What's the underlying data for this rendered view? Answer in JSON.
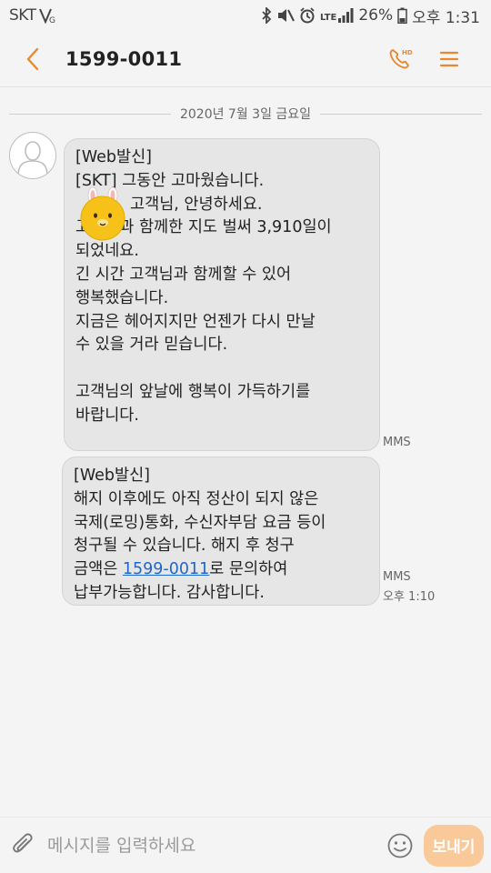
{
  "status_bar": {
    "carrier": "SKT",
    "network": "LTE",
    "battery": "26%",
    "time": "오후 1:31"
  },
  "header": {
    "title": "1599-0011",
    "icons": [
      "back-arrow-icon",
      "phone-hd-icon",
      "menu-icon"
    ],
    "accent_color": "#e8892f"
  },
  "conversation": {
    "date_label": "2020년 7월 3일 금요일",
    "messages": [
      {
        "lines": [
          "[Web발신]",
          "[SKT] 그동안 고마웠습니다.",
          "고객님, 안녕하세요.",
          "고객님과 함께한 지도 벌써 3,910일이",
          "되었네요.",
          "긴 시간 고객님과 함께할 수 있어",
          "행복했습니다.",
          "지금은 헤어지지만 언젠가 다시 만날",
          "수 있을 거라 믿습니다.",
          "",
          "고객님의 앞날에 행복이 가득하기를",
          "바랍니다."
        ],
        "type": "MMS"
      },
      {
        "line1": "[Web발신]",
        "line2": "해지 이후에도 아직 정산이 되지 않은",
        "line3": "국제(로밍)통화, 수신자부담 요금 등이",
        "line4": "청구될 수 있습니다. 해지 후 청구",
        "line5_prefix": "금액은 ",
        "line5_link": "1599-0011",
        "line5_suffix": "로 문의하여",
        "line6": "납부가능합니다. 감사합니다.",
        "type": "MMS",
        "time": "오후 1:10"
      }
    ],
    "bubble_color": "#e6e6e6",
    "link_color": "#1f66c9"
  },
  "composer": {
    "placeholder": "메시지를 입력하세요",
    "send_label": "보내기",
    "send_color": "#f9c99a"
  }
}
